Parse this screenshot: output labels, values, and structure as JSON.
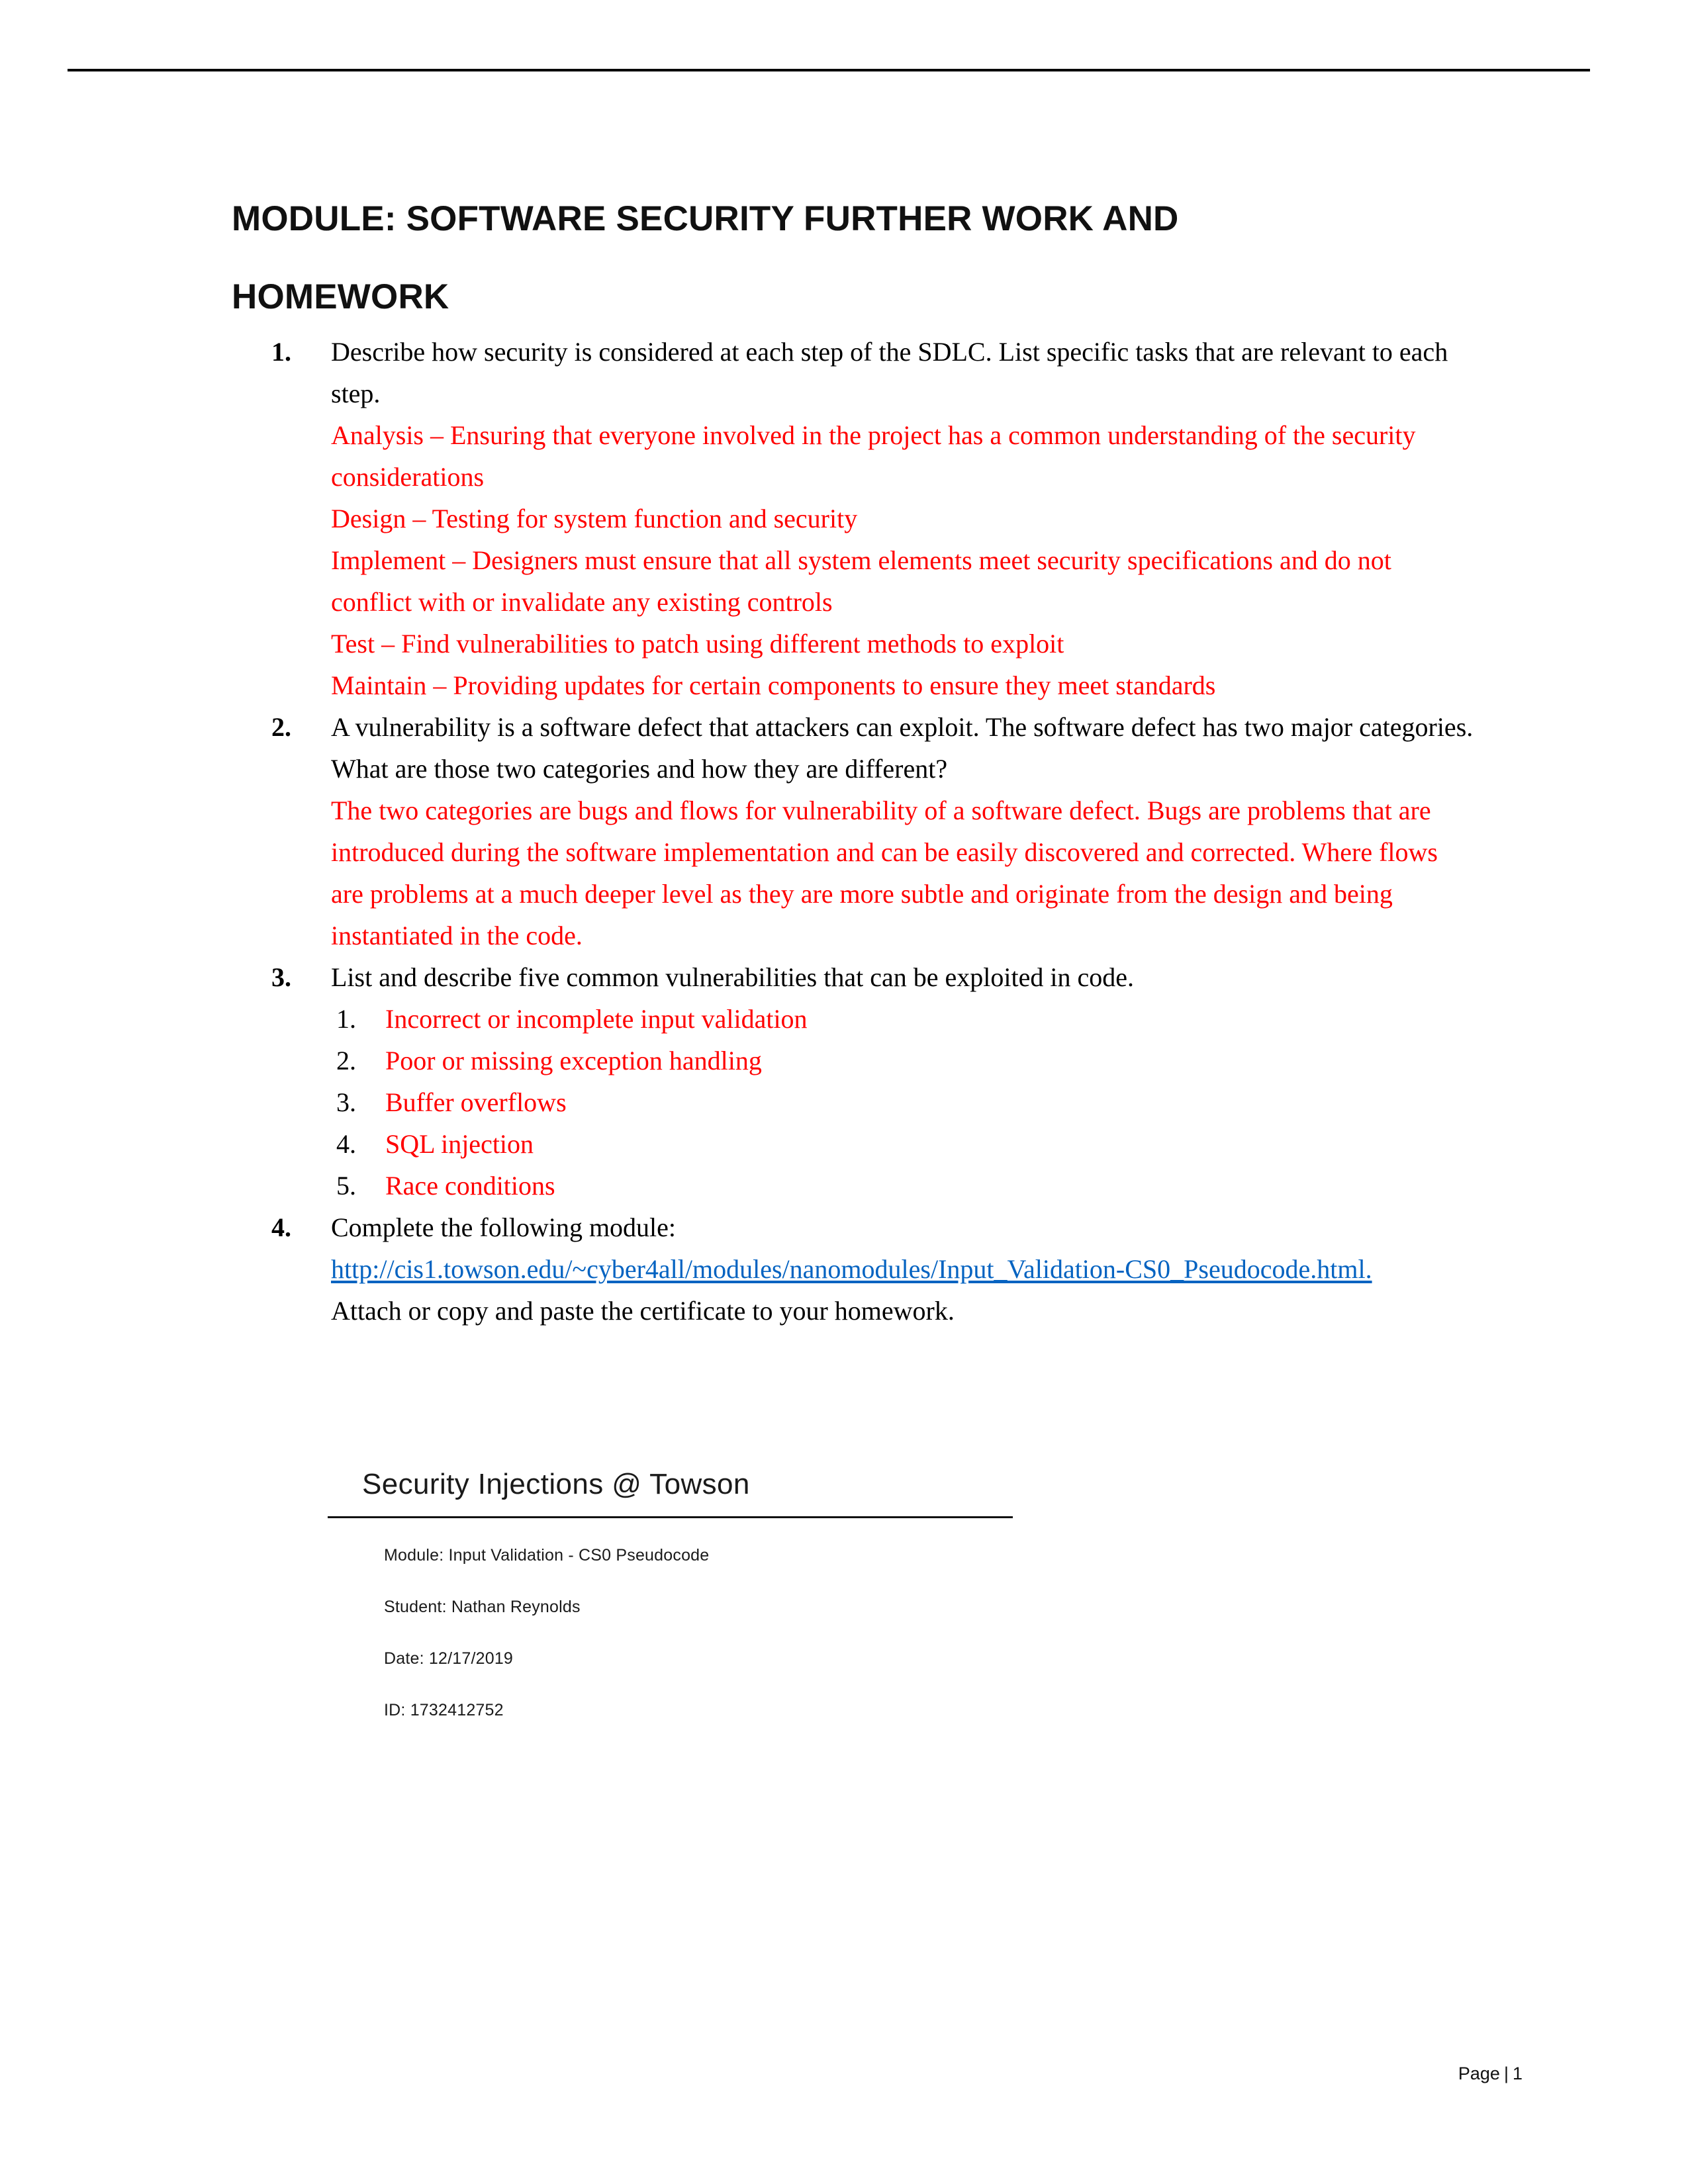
{
  "document": {
    "title_line_1": "MODULE: SOFTWARE SECURITY FURTHER WORK AND",
    "title_line_2": "HOMEWORK",
    "title_full": "MODULE: SOFTWARE SECURITY FURTHER WORK AND HOMEWORK"
  },
  "items": {
    "q1": {
      "number": "1.",
      "question": "Describe how security is considered at each step of the SDLC. List specific tasks that are relevant to each step.",
      "answers": [
        "Analysis – Ensuring that everyone involved in the project has a common understanding of the security considerations",
        "Design – Testing for system function and security",
        "Implement – Designers must ensure that all system elements meet security specifications and do not conflict with or invalidate any existing controls",
        "Test – Find vulnerabilities to patch using different methods to exploit",
        "Maintain – Providing updates for certain components to ensure they meet standards"
      ]
    },
    "q2": {
      "number": "2.",
      "question": "A vulnerability is a software defect that attackers can exploit. The software defect has two major categories. What are those two categories and how they are different?",
      "answer": "The two categories are bugs and flows for vulnerability of a software defect. Bugs are problems that are introduced during the software implementation and can be easily discovered and corrected. Where flows are problems at a much deeper level as they are more subtle and originate from the design and being instantiated in the code."
    },
    "q3": {
      "number": "3.",
      "question": "List and describe five common vulnerabilities that can be exploited in code.",
      "sublist": [
        {
          "number": "1.",
          "text": "Incorrect or incomplete input validation"
        },
        {
          "number": "2.",
          "text": "Poor or missing exception handling"
        },
        {
          "number": "3.",
          "text": "Buffer overflows"
        },
        {
          "number": "4.",
          "text": "SQL injection"
        },
        {
          "number": "5.",
          "text": "Race conditions"
        }
      ]
    },
    "q4": {
      "number": "4.",
      "question": "Complete the following module:",
      "link_text": "http://cis1.towson.edu/~cyber4all/modules/nanomodules/Input_Validation-CS0_Pseudocode.html.",
      "instruction": "Attach or copy and paste the certificate to your homework."
    }
  },
  "certificate": {
    "heading": "Security Injections @ Towson",
    "module_line": "Module: Input Validation - CS0 Pseudocode",
    "student_line": "Student: Nathan Reynolds",
    "date_line": "Date: 12/17/2019",
    "id_line": "ID: 1732412752"
  },
  "footer": {
    "page_label": "Page",
    "separator": "|",
    "page_number": "1"
  },
  "colors": {
    "answer_red": "#ff0000",
    "link_blue": "#0563c1",
    "text_black": "#000000"
  }
}
